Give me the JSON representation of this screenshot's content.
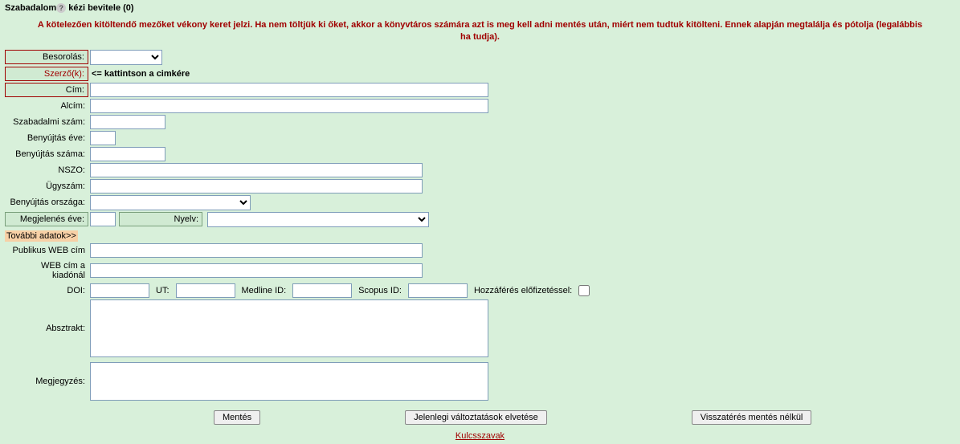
{
  "header": {
    "title_prefix": "Szabadalom",
    "title_suffix": " kézi bevitele (0)"
  },
  "warning": "A kötelezően kitöltendő mezőket vékony keret jelzi. Ha nem töltjük ki őket, akkor a könyvtáros számára azt is meg kell adni mentés után, miért nem tudtuk kitölteni. Ennek alapján megtalálja és pótolja (legalábbis ha tudja).",
  "labels": {
    "besorolas": "Besorolás:",
    "szerzok": "Szerző(k):",
    "cim": "Cím:",
    "alcim": "Alcím:",
    "szabadalmi_szam": "Szabadalmi szám:",
    "benyujtas_eve": "Benyújtás éve:",
    "benyujtas_szama": "Benyújtás száma:",
    "nszo": "NSZO:",
    "ugyszam": "Ügyszám:",
    "benyujtas_orszaga": "Benyújtás országa:",
    "megjelenes_eve": "Megjelenés éve:",
    "nyelv": "Nyelv:",
    "publikus_web": "Publikus WEB cím",
    "web_kiado": "WEB cím a kiadónál",
    "doi": "DOI:",
    "ut": "UT:",
    "medline": "Medline ID:",
    "scopus": "Scopus ID:",
    "hozzaferes": "Hozzáférés előfizetéssel:",
    "absztrakt": "Absztrakt:",
    "megjegyzes": "Megjegyzés:"
  },
  "hints": {
    "szerzok": "<= kattintson a cimkére"
  },
  "section": {
    "tovabbi": "További adatok>>"
  },
  "buttons": {
    "mentes": "Mentés",
    "elvetes": "Jelenlegi változtatások elvetése",
    "vissza": "Visszatérés mentés nélkül"
  },
  "footer": {
    "kulcsszavak": "Kulcsszavak"
  },
  "values": {
    "besorolas": "",
    "cim": "",
    "alcim": "",
    "szabadalmi_szam": "",
    "benyujtas_eve": "",
    "benyujtas_szama": "",
    "nszo": "",
    "ugyszam": "",
    "benyujtas_orszaga": "",
    "megjelenes_eve": "",
    "nyelv": "",
    "publikus_web": "",
    "web_kiado": "",
    "doi": "",
    "ut": "",
    "medline": "",
    "scopus": "",
    "absztrakt": "",
    "megjegyzes": ""
  }
}
